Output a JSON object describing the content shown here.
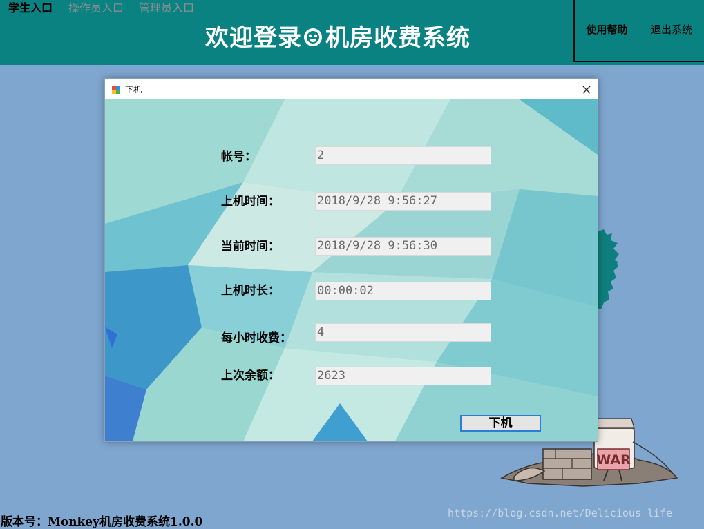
{
  "nav": {
    "tabs": [
      {
        "label": "学生入口",
        "active": true
      },
      {
        "label": "操作员入口",
        "active": false
      },
      {
        "label": "管理员入口",
        "active": false
      }
    ]
  },
  "header": {
    "title_part1": "欢迎登录",
    "title_part2": "机房收费系统",
    "help_label": "使用帮助",
    "exit_label": "退出系统",
    "bg_color": "#0b8282"
  },
  "dialog": {
    "title": "下机",
    "fields": [
      {
        "label": "帐号：",
        "value": "2"
      },
      {
        "label": "上机时间：",
        "value": "2018/9/28 9:56:27"
      },
      {
        "label": "当前时间：",
        "value": "2018/9/28 9:56:30"
      },
      {
        "label": "上机时长：",
        "value": "00:00:02"
      },
      {
        "label": "每小时收费：",
        "value": "4"
      },
      {
        "label": "上次余额：",
        "value": "2623"
      }
    ],
    "logout_label": "下机"
  },
  "decor": {
    "war_sign_text": "WAR"
  },
  "footer": {
    "version": "版本号：Monkey机房收费系统1.0.0",
    "watermark": "https://blog.csdn.net/Delicious_life"
  }
}
